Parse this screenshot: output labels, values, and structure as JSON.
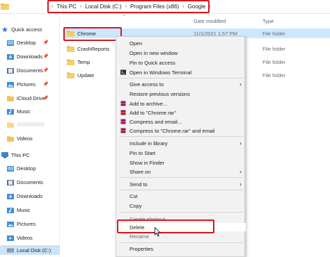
{
  "address_bar": {
    "folder_icon": "folder-icon",
    "crumbs": [
      "This PC",
      "Local Disk (C:)",
      "Program Files (x86)",
      "Google"
    ],
    "separator": "›"
  },
  "sidebar": {
    "items": [
      {
        "label": "Quick access",
        "icon": "star-icon",
        "pinned": false
      },
      {
        "label": "Desktop",
        "icon": "desktop-folder-icon",
        "pinned": true
      },
      {
        "label": "Downloads",
        "icon": "downloads-folder-icon",
        "pinned": true
      },
      {
        "label": "Documents",
        "icon": "documents-folder-icon",
        "pinned": true
      },
      {
        "label": "Pictures",
        "icon": "pictures-folder-icon",
        "pinned": true
      },
      {
        "label": "iCloud Drive",
        "icon": "icloud-folder-icon",
        "pinned": true
      },
      {
        "label": "Music",
        "icon": "music-folder-icon",
        "pinned": false
      },
      {
        "label": "Videos",
        "icon": "videos-folder-icon",
        "pinned": false
      },
      {
        "label": "This PC",
        "icon": "this-pc-icon",
        "pinned": false
      },
      {
        "label": "Desktop",
        "icon": "desktop-folder-icon",
        "pinned": false
      },
      {
        "label": "Documents",
        "icon": "documents-folder-icon",
        "pinned": false
      },
      {
        "label": "Downloads",
        "icon": "downloads-folder-icon",
        "pinned": false
      },
      {
        "label": "Music",
        "icon": "music-folder-icon",
        "pinned": false
      },
      {
        "label": "Pictures",
        "icon": "pictures-folder-icon",
        "pinned": false
      },
      {
        "label": "Videos",
        "icon": "videos-folder-icon",
        "pinned": false
      },
      {
        "label": "Local Disk (C:)",
        "icon": "local-disk-icon",
        "pinned": false
      }
    ]
  },
  "columns": {
    "date_modified": "Date modified",
    "type": "Type"
  },
  "files": [
    {
      "name": "Chrome",
      "date": "11/1/2021 1:57 PM",
      "type": "File folder",
      "selected": true
    },
    {
      "name": "CrashReports",
      "date": "",
      "type": "File folder",
      "selected": false
    },
    {
      "name": "Temp",
      "date": "",
      "type": "File folder",
      "selected": false
    },
    {
      "name": "Update",
      "date": "",
      "type": "File folder",
      "selected": false
    }
  ],
  "context_menu": {
    "items": [
      {
        "label": "Open",
        "icon": "",
        "submenu": false
      },
      {
        "label": "Open in new window",
        "icon": "",
        "submenu": false
      },
      {
        "label": "Pin to Quick access",
        "icon": "",
        "submenu": false
      },
      {
        "label": "Open in Windows Terminal",
        "icon": "terminal-icon",
        "submenu": false
      },
      {
        "label": "Give access to",
        "icon": "",
        "submenu": true
      },
      {
        "label": "Restore previous versions",
        "icon": "",
        "submenu": false
      },
      {
        "label": "Add to archive...",
        "icon": "winrar-icon",
        "submenu": false
      },
      {
        "label": "Add to \"Chrome.rar\"",
        "icon": "winrar-icon",
        "submenu": false
      },
      {
        "label": "Compress and email...",
        "icon": "winrar-icon",
        "submenu": false
      },
      {
        "label": "Compress to \"Chrome.rar\" and email",
        "icon": "winrar-icon",
        "submenu": false
      },
      {
        "label": "Include in library",
        "icon": "",
        "submenu": true
      },
      {
        "label": "Pin to Start",
        "icon": "",
        "submenu": false
      },
      {
        "label": "Show in Finder",
        "icon": "",
        "submenu": false
      },
      {
        "label": "Share on",
        "icon": "",
        "submenu": true
      },
      {
        "label": "Send to",
        "icon": "",
        "submenu": true
      },
      {
        "label": "Cut",
        "icon": "",
        "submenu": false
      },
      {
        "label": "Copy",
        "icon": "",
        "submenu": false
      },
      {
        "label": "Create shortcut",
        "icon": "",
        "submenu": false
      },
      {
        "label": "Delete",
        "icon": "",
        "submenu": false,
        "hover": true
      },
      {
        "label": "Rename",
        "icon": "",
        "submenu": false
      },
      {
        "label": "Properties",
        "icon": "",
        "submenu": false
      }
    ],
    "submenu_arrow": "›"
  },
  "colors": {
    "highlight_red": "#d6161e",
    "folder_yellow": "#f2c55c",
    "selection_blue": "#cce8ff",
    "menu_bg": "#f2f2f2"
  }
}
